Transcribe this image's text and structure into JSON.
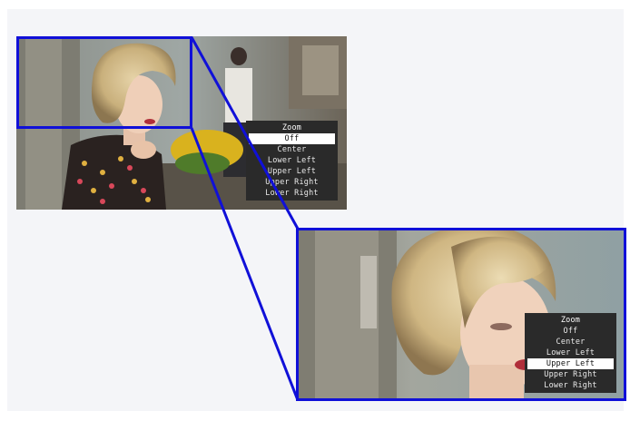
{
  "menu_small": {
    "title": "Zoom",
    "items": [
      "Off",
      "Center",
      "Lower Left",
      "Upper Left",
      "Upper Right",
      "Lower Right"
    ],
    "selected": "Off"
  },
  "menu_large": {
    "title": "Zoom",
    "items": [
      "Off",
      "Center",
      "Lower Left",
      "Upper Left",
      "Upper Right",
      "Lower Right"
    ],
    "selected": "Upper Left"
  },
  "colors": {
    "frame": "#1010d8",
    "menu_bg": "#2a2a2a",
    "menu_selected_bg": "#ffffff",
    "panel_bg": "#f4f5f8"
  }
}
